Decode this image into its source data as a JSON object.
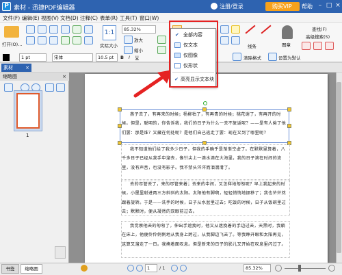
{
  "app": {
    "title": "素材 - 迅捷PDF编辑器",
    "login": "注册/登录",
    "vip": "购买VIP",
    "help": "帮助"
  },
  "menu": [
    "文件(F)",
    "编辑(E)",
    "视图(V)",
    "文档(D)",
    "注释(C)",
    "表单(R)",
    "工具(T)",
    "窗口(W)"
  ],
  "ribbon": {
    "open": "打开(O)...",
    "actual_size": "实际大小",
    "zoom": "85.32%",
    "zoom_in": "放大",
    "zoom_out": "缩小",
    "line": "线条",
    "stamp": "图章",
    "find": "查找(F)",
    "adv_find": "高级搜索(S)",
    "clear_format": "清除格式",
    "set_default": "设置为默认",
    "font": "宋体",
    "font_size": "10.5 pt",
    "line_width": "1 pt"
  },
  "dropdown": {
    "items": [
      {
        "label": "全部内容",
        "checked": true
      },
      {
        "label": "仅文本",
        "checked": false
      },
      {
        "label": "仅图像",
        "checked": false
      },
      {
        "label": "仅形状",
        "checked": false
      },
      {
        "label": "高亮显示文本块",
        "checked": true
      }
    ]
  },
  "tabs": {
    "document": "素材"
  },
  "left_panel": {
    "title": "缩略图",
    "page_number": "1",
    "tab_bookmarks": "书签",
    "tab_thumbs": "缩略图"
  },
  "document": {
    "paragraphs": [
      "燕子去了，有再来的时候；杨柳枯了，有再青的时候；桃花谢了，有再开的时候。但是，聪明的，你告诉我，我们的日子为什么一去不复返呢？——是有人偷了他们罢：那是谁？又藏在何处呢？是他们自己逃走了罢：现在又到了哪里呢？",
      "我不知道他们给了我多少日子，但我的手确乎是渐渐空虚了。在默默里算着，八千多日子已经从我手中溜去，像针尖上一滴水滴在大海里，我的日子滴在时间的流里，没有声音，也没有影子。我不禁头涔涔而泪潸潸了。",
      "去的尽管去了，来的尽管来着；去来的中间，又怎样地匆匆呢？早上我起来的时候，小屋里射进两三方斜斜的太阳。太阳他有脚啊，轻轻悄悄地挪移了；我也茫茫然跟着旋转。于是——洗手的时候，日子从水盆里过去；吃饭的时候，日子从饭碗里过去；默默时，便从凝然的双眼前过去。",
      "我觉察他去的匆匆了，伸出手遮挽时，他又从遮挽着的手边过去，天黑时，我躺在床上，他便伶伶俐俐地从我身上跨过，从我脚边飞去了。等我睁开眼和太阳再见，这算又溜走了一日。我掩着面叹息。但是新来的日子的影儿又开始在叹息里闪过了。"
    ]
  },
  "status": {
    "page": "1",
    "total": "/ 1",
    "zoom": "85.32%"
  }
}
